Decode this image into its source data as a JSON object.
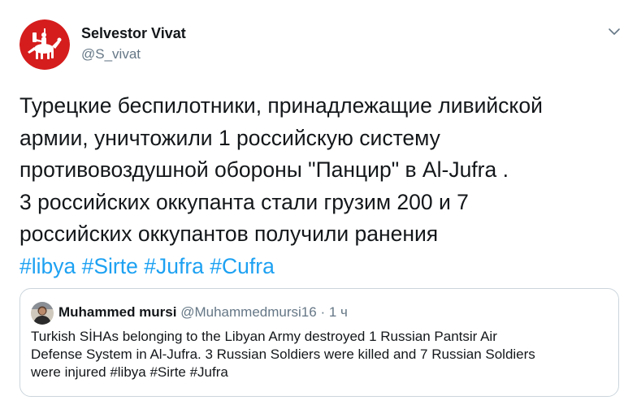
{
  "author": {
    "name": "Selvestor Vivat",
    "handle": "@S_vivat"
  },
  "tweet": {
    "lines": [
      "Турецкие беспилотники, принадлежащие ливийской",
      "армии, уничтожили 1 российскую систему",
      "противовоздушной обороны \"Панцир\" в Al-Jufra .",
      "3 российских оккупанта стали грузим 200 и 7",
      "российских оккупантов получили ранения"
    ],
    "hashtags": [
      "#libya",
      "#Sirte",
      "#Jufra",
      "#Cufra"
    ]
  },
  "quoted": {
    "name": "Muhammed mursi",
    "handle": "@Muhammedmursi16",
    "separator": "·",
    "time": "1 ч",
    "lines": [
      "Turkish SİHAs belonging to the Libyan Army destroyed 1 Russian Pantsir Air",
      "Defense System in Al-Jufra. 3 Russian Soldiers were killed and 7 Russian Soldiers",
      "were injured #libya #Sirte #Jufra"
    ]
  },
  "icons": {
    "menu": "chevron-down-icon",
    "avatar": "pahonia-emblem",
    "quoted_avatar": "person-photo"
  },
  "colors": {
    "link": "#1da1f2",
    "text": "#14171a",
    "muted": "#657786",
    "border": "#ccd6dd",
    "avatar_red": "#d51d1d"
  }
}
